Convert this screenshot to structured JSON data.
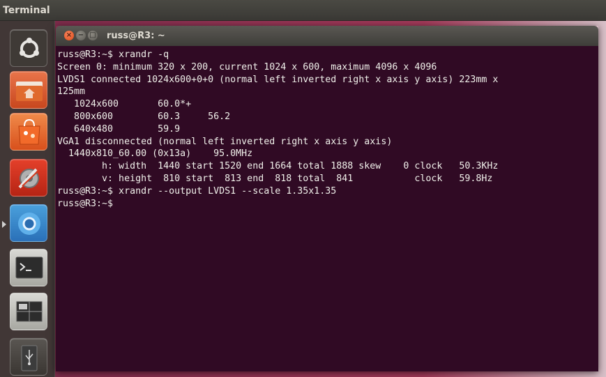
{
  "topbar": {
    "title": "Terminal"
  },
  "launcher": {
    "items": [
      {
        "name": "dash-home-button",
        "icon": "ubuntu-logo-icon"
      },
      {
        "name": "files-button",
        "icon": "home-folder-icon"
      },
      {
        "name": "software-center-button",
        "icon": "shopping-bag-icon"
      },
      {
        "name": "system-settings-button",
        "icon": "settings-gear-icon"
      },
      {
        "name": "chromium-button",
        "icon": "chromium-icon"
      },
      {
        "name": "terminal-button",
        "icon": "terminal-icon"
      },
      {
        "name": "workspace-switcher-button",
        "icon": "workspaces-icon"
      },
      {
        "name": "usb-drive-button",
        "icon": "usb-icon"
      }
    ]
  },
  "window": {
    "title": "russ@R3: ~",
    "buttons": {
      "close": "×",
      "minimize": "−",
      "maximize": "□"
    }
  },
  "terminal": {
    "lines": [
      "russ@R3:~$ xrandr -q",
      "Screen 0: minimum 320 x 200, current 1024 x 600, maximum 4096 x 4096",
      "LVDS1 connected 1024x600+0+0 (normal left inverted right x axis y axis) 223mm x",
      "125mm",
      "   1024x600       60.0*+",
      "   800x600        60.3     56.2",
      "   640x480        59.9",
      "VGA1 disconnected (normal left inverted right x axis y axis)",
      "  1440x810_60.00 (0x13a)    95.0MHz",
      "        h: width  1440 start 1520 end 1664 total 1888 skew    0 clock   50.3KHz",
      "        v: height  810 start  813 end  818 total  841           clock   59.8Hz",
      "russ@R3:~$ xrandr --output LVDS1 --scale 1.35x1.35",
      "russ@R3:~$"
    ]
  },
  "colors": {
    "terminal_bg": "#300a24",
    "terminal_fg": "#f0f0ea",
    "accent": "#df4a16"
  }
}
